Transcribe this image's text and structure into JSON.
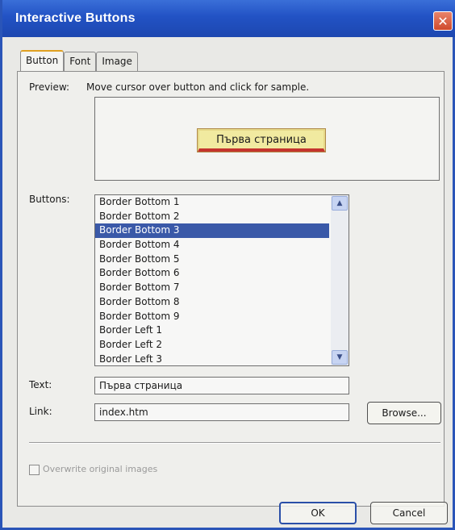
{
  "window": {
    "title": "Interactive Buttons",
    "close_glyph": "✕"
  },
  "tabs": [
    {
      "label": "Button",
      "active": true
    },
    {
      "label": "Font",
      "active": false
    },
    {
      "label": "Image",
      "active": false
    }
  ],
  "preview": {
    "label": "Preview:",
    "hint": "Move cursor over button and click for sample.",
    "sample_text": "Първа страница"
  },
  "buttons": {
    "label": "Buttons:",
    "items": [
      "Border Bottom 1",
      "Border Bottom 2",
      "Border Bottom 3",
      "Border Bottom 4",
      "Border Bottom 5",
      "Border Bottom 6",
      "Border Bottom 7",
      "Border Bottom 8",
      "Border Bottom 9",
      "Border Left 1",
      "Border Left 2",
      "Border Left 3"
    ],
    "selected": "Border Bottom 3",
    "scroll_up_icon": "▲",
    "scroll_down_icon": "▼"
  },
  "text_field": {
    "label": "Text:",
    "value": "Първа страница"
  },
  "link_field": {
    "label": "Link:",
    "value": "index.htm",
    "browse_label": "Browse..."
  },
  "overwrite": {
    "label": "Overwrite original images",
    "checked": false
  },
  "footer": {
    "ok_label": "OK",
    "cancel_label": "Cancel"
  },
  "colors": {
    "titlebar": "#2252c4",
    "selection": "#3a59a8",
    "sample_fill": "#f1eaa0",
    "sample_border_bottom": "#c4342e"
  }
}
